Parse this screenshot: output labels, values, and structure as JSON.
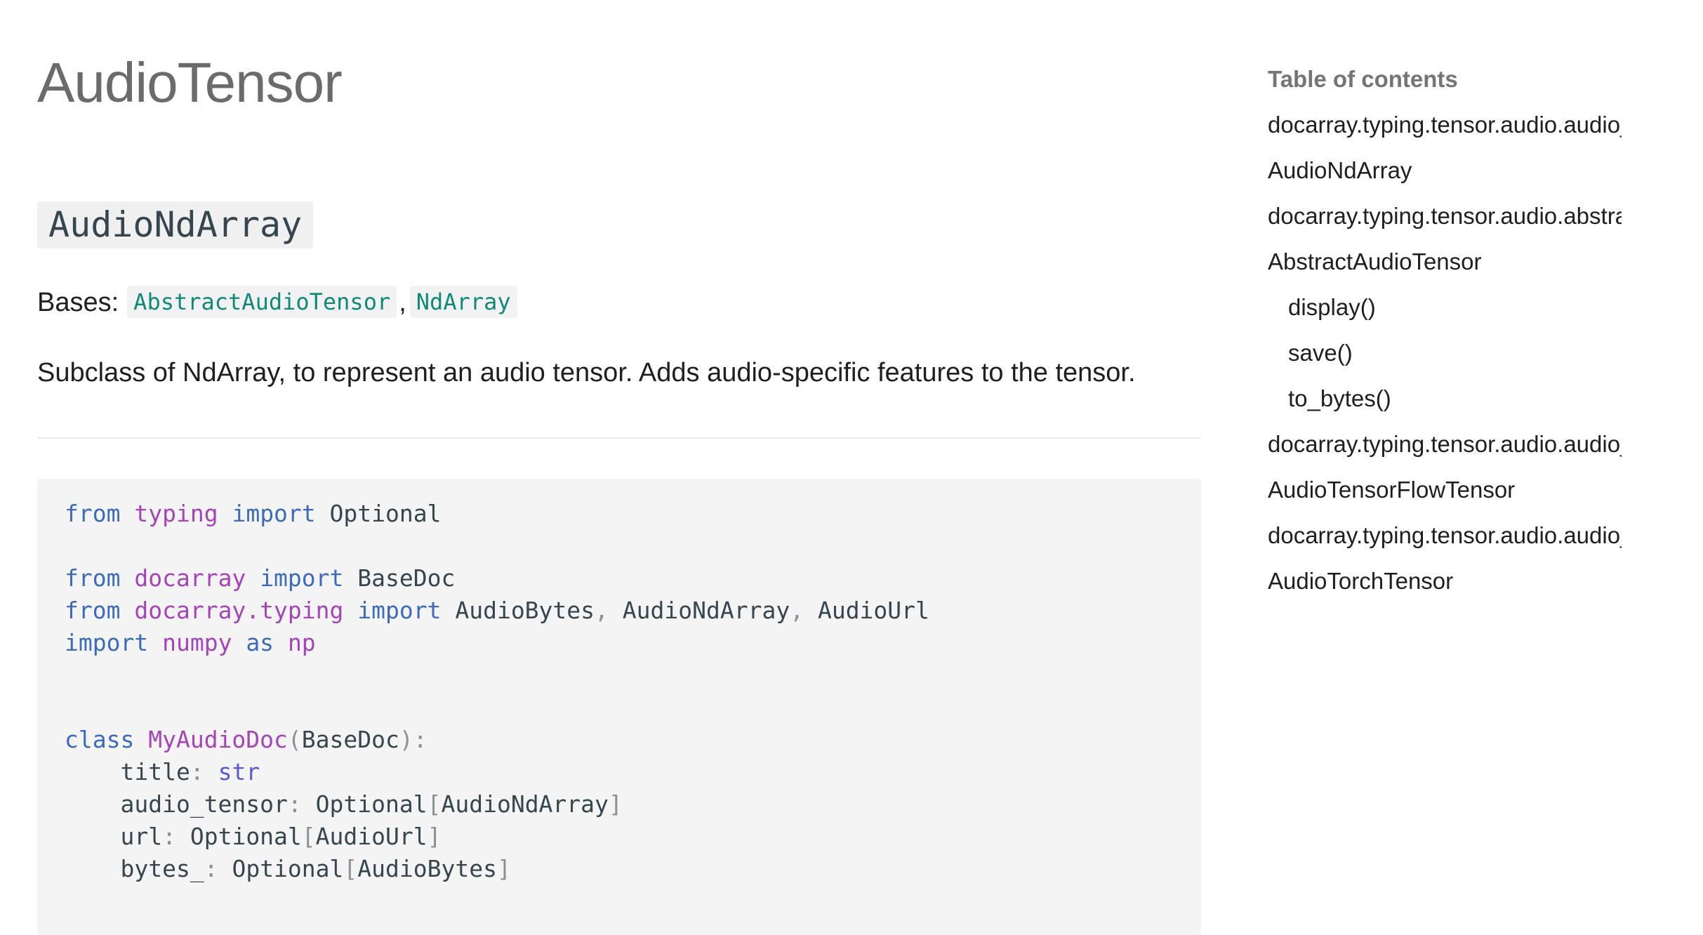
{
  "page": {
    "title": "AudioTensor"
  },
  "class_section": {
    "name": "AudioNdArray",
    "bases_label": "Bases:",
    "bases": [
      "AbstractAudioTensor",
      "NdArray"
    ],
    "bases_separator": ",",
    "description": "Subclass of NdArray, to represent an audio tensor. Adds audio-specific features to the tensor."
  },
  "code_example": {
    "tokens": {
      "from": "from",
      "import": "import",
      "as": "as",
      "class": "class",
      "typing": "typing",
      "Optional": "Optional",
      "docarray": "docarray",
      "BaseDoc": "BaseDoc",
      "docarray_typing": "docarray.typing",
      "AudioBytes": "AudioBytes",
      "AudioNdArray": "AudioNdArray",
      "AudioUrl": "AudioUrl",
      "numpy": "numpy",
      "np": "np",
      "MyAudioDoc": "MyAudioDoc",
      "title": "title",
      "str": "str",
      "audio_tensor": "audio_tensor",
      "url": "url",
      "bytes_": "bytes_"
    }
  },
  "toc": {
    "title": "Table of contents",
    "items": [
      {
        "label": "docarray.typing.tensor.audio.audio_ndarray",
        "nested": false
      },
      {
        "label": "AudioNdArray",
        "nested": false
      },
      {
        "label": "docarray.typing.tensor.audio.abstract_audio_tensor",
        "nested": false
      },
      {
        "label": "AbstractAudioTensor",
        "nested": false
      },
      {
        "label": "display()",
        "nested": true
      },
      {
        "label": "save()",
        "nested": true
      },
      {
        "label": "to_bytes()",
        "nested": true
      },
      {
        "label": "docarray.typing.tensor.audio.audio_tensorflow_tensor",
        "nested": false
      },
      {
        "label": "AudioTensorFlowTensor",
        "nested": false
      },
      {
        "label": "docarray.typing.tensor.audio.audio_torch_tensor",
        "nested": false
      },
      {
        "label": "AudioTorchTensor",
        "nested": false
      }
    ]
  }
}
